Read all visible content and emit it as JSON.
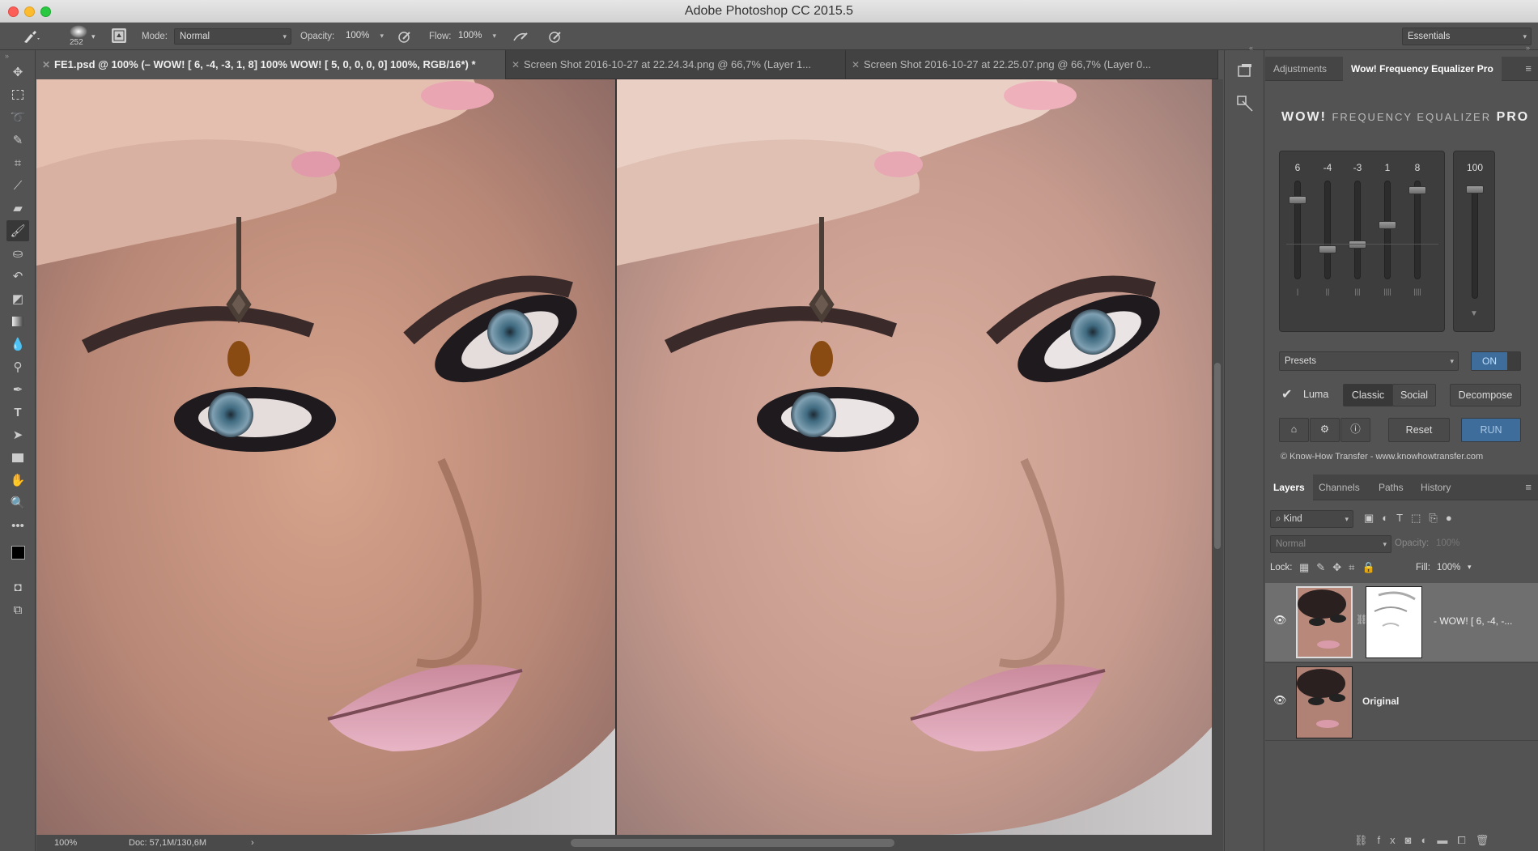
{
  "window": {
    "title": "Adobe Photoshop CC 2015.5"
  },
  "options": {
    "brush_size": "252",
    "mode_label": "Mode:",
    "mode_value": "Normal",
    "opacity_label": "Opacity:",
    "opacity_value": "100%",
    "flow_label": "Flow:",
    "flow_value": "100%",
    "workspace": "Essentials"
  },
  "tabs": [
    {
      "label": "FE1.psd @ 100% (– WOW! [ 6, -4, -3, 1, 8] 100% WOW! [ 5, 0, 0, 0, 0] 100%, RGB/16*) *"
    },
    {
      "label": "Screen Shot 2016-10-27 at 22.24.34.png @ 66,7% (Layer 1..."
    },
    {
      "label": "Screen Shot 2016-10-27 at 22.25.07.png @ 66,7% (Layer 0..."
    }
  ],
  "status": {
    "zoom": "100%",
    "doc": "Doc: 57,1M/130,6M"
  },
  "adjustments_panel": {
    "tabs": [
      "Adjustments",
      "Wow! Frequency Equalizer Pro"
    ],
    "plugin_title_wow": "WOW!",
    "plugin_title_mid": "FREQUENCY EQUALIZER",
    "plugin_title_pro": "PRO",
    "sliders": [
      {
        "label": "6",
        "value": 6
      },
      {
        "label": "-4",
        "value": -4
      },
      {
        "label": "-3",
        "value": -3
      },
      {
        "label": "1",
        "value": 1
      },
      {
        "label": "8",
        "value": 8
      }
    ],
    "master": {
      "label": "100",
      "value": 100
    },
    "presets_label": "Presets",
    "on_label": "ON",
    "luma_label": "Luma",
    "classic_label": "Classic",
    "social_label": "Social",
    "decompose_label": "Decompose",
    "reset_label": "Reset",
    "run_label": "RUN",
    "credit": "© Know-How Transfer - www.knowhowtransfer.com"
  },
  "layers_panel": {
    "tabs": [
      "Layers",
      "Channels",
      "Paths",
      "History"
    ],
    "kind_label": "Kind",
    "blend_mode": "Normal",
    "opacity_label": "Opacity:",
    "opacity_value": "100%",
    "lock_label": "Lock:",
    "fill_label": "Fill:",
    "fill_value": "100%",
    "layers": [
      {
        "name": "- WOW! [ 6, -4, -..."
      },
      {
        "name": "Original"
      }
    ]
  },
  "colors": {
    "accent_blue": "#3e6d9c",
    "panel_bg": "#535353"
  }
}
